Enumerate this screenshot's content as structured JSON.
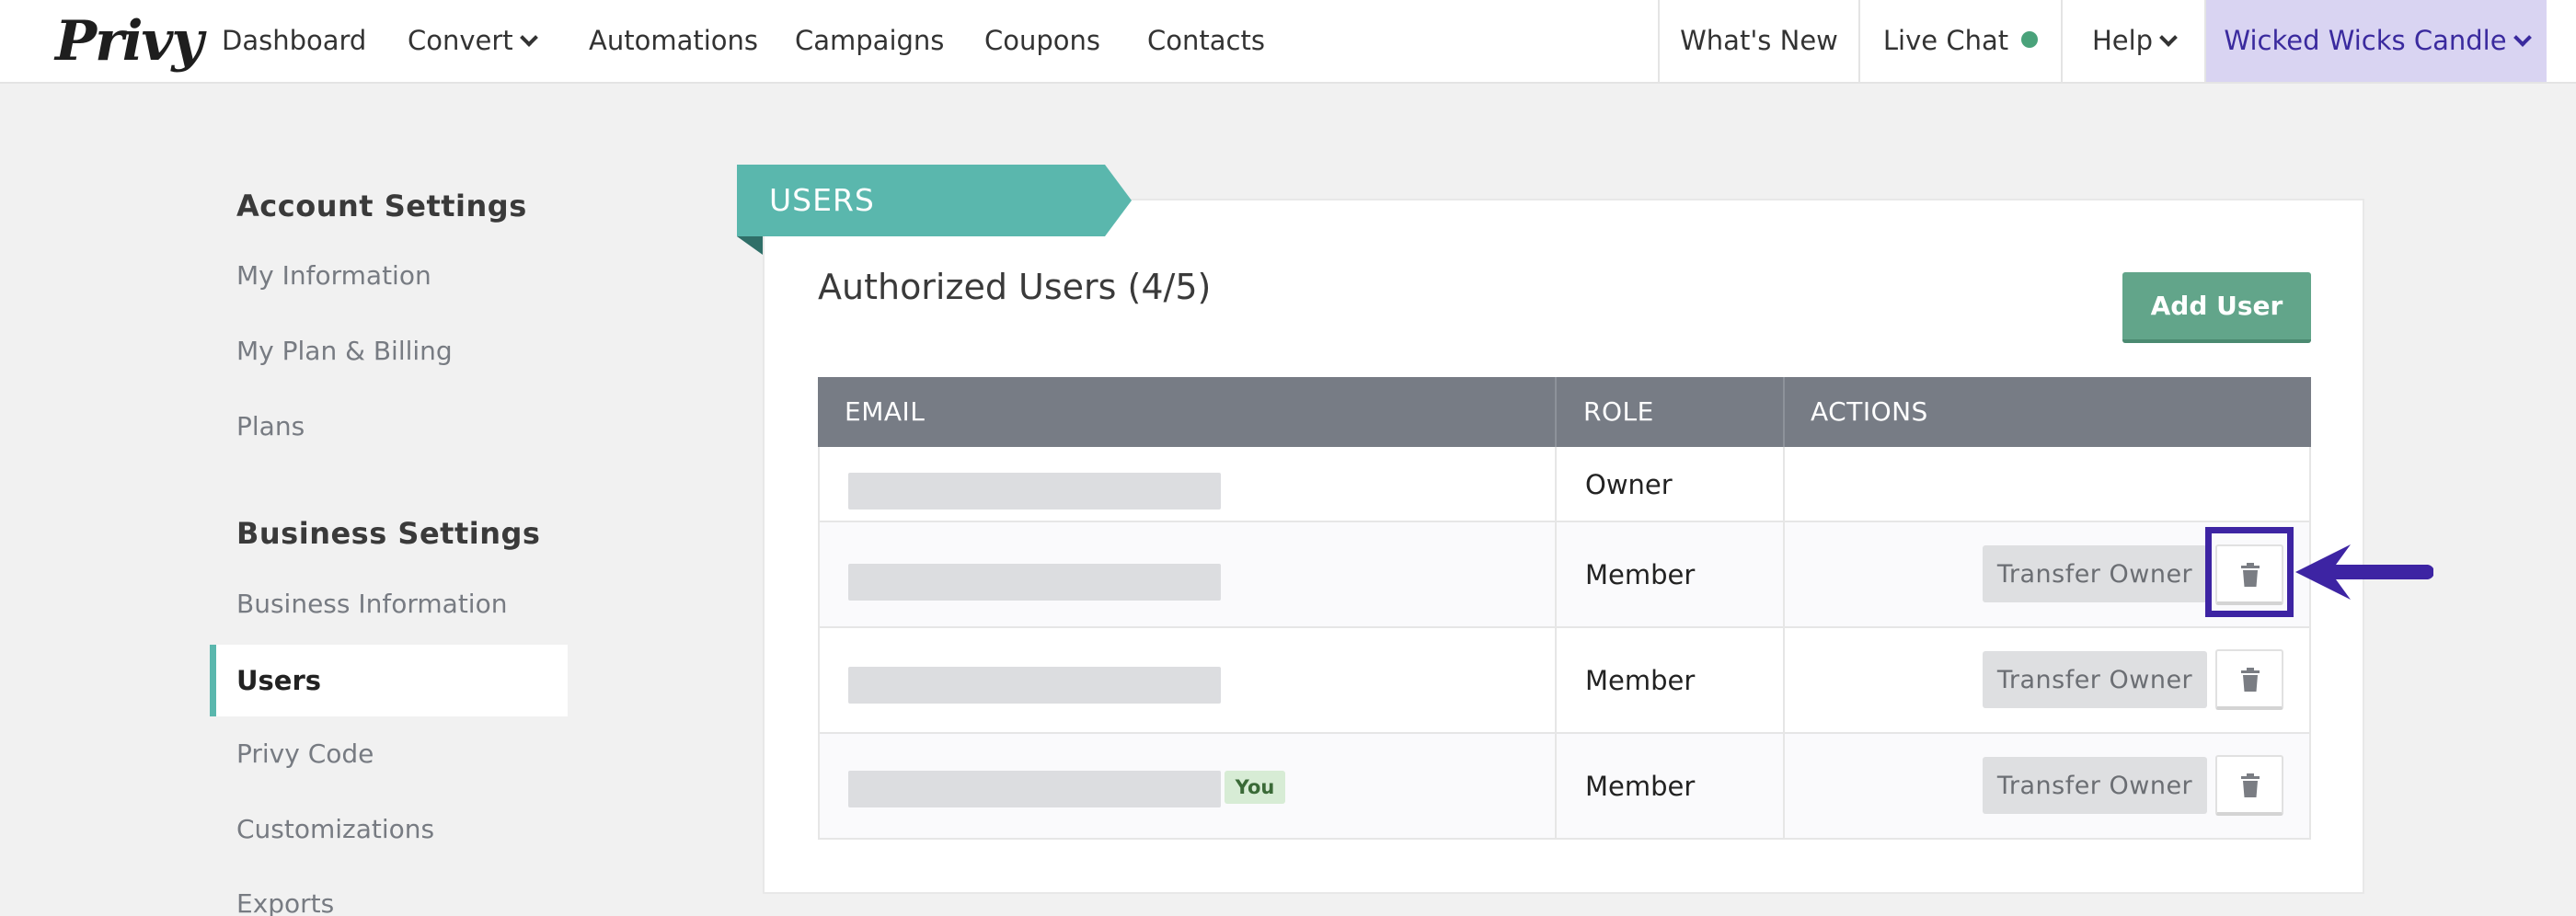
{
  "nav": {
    "logo": "Privy",
    "items": [
      "Dashboard",
      "Convert",
      "Automations",
      "Campaigns",
      "Coupons",
      "Contacts"
    ],
    "whats_new": "What's New",
    "live_chat": "Live Chat",
    "help": "Help",
    "store": "Wicked Wicks Candle"
  },
  "sidebar": {
    "account_heading": "Account Settings",
    "account_items": [
      "My Information",
      "My Plan & Billing",
      "Plans"
    ],
    "business_heading": "Business Settings",
    "business_items": [
      "Business Information",
      "Users",
      "Privy Code",
      "Customizations",
      "Exports"
    ],
    "active": "Users"
  },
  "panel": {
    "ribbon": "USERS",
    "title": "Authorized Users (4/5)",
    "add_user": "Add User"
  },
  "table": {
    "headers": [
      "EMAIL",
      "ROLE",
      "ACTIONS"
    ],
    "rows": [
      {
        "role": "Owner"
      },
      {
        "role": "Member",
        "action": "Transfer Owner"
      },
      {
        "role": "Member",
        "action": "Transfer Owner"
      },
      {
        "role": "Member",
        "action": "Transfer Owner",
        "badge": "You"
      }
    ]
  },
  "colors": {
    "accent_teal": "#5ab7ad",
    "add_user_green": "#62a58a",
    "highlight_purple": "#3d24a3",
    "table_header": "#777c85"
  }
}
